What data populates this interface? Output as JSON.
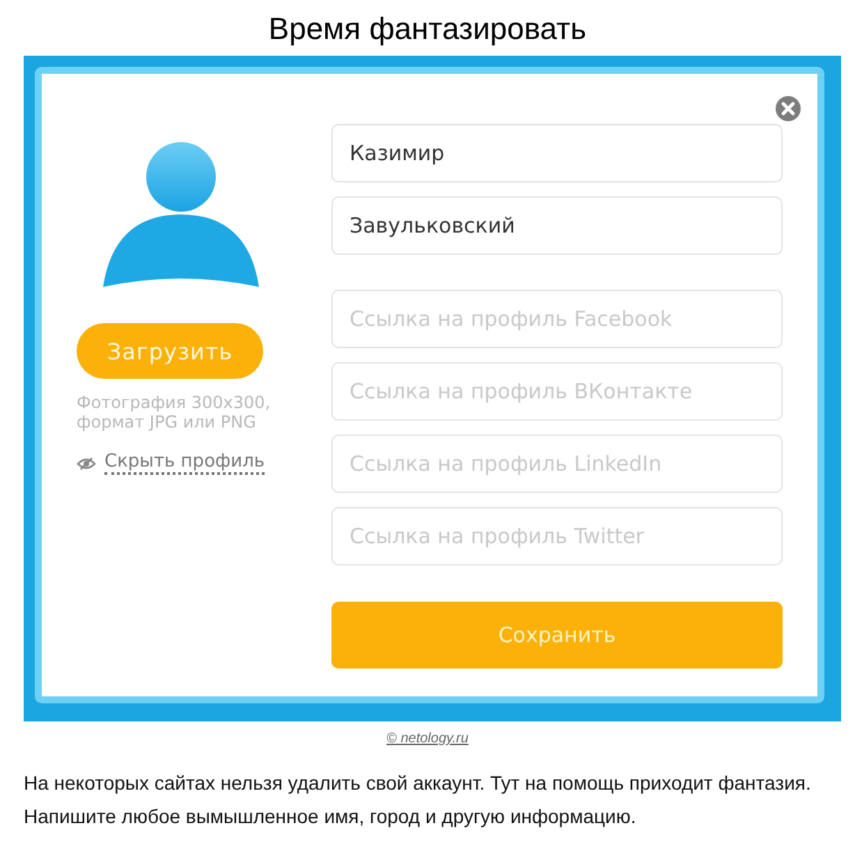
{
  "title": "Время фантазировать",
  "profile": {
    "upload_button": "Загрузить",
    "photo_hint": "Фотография 300x300, формат JPG или PNG",
    "hide_link": "Скрыть профиль"
  },
  "fields": [
    {
      "value": "Казимир"
    },
    {
      "value": "Завульковский"
    },
    {
      "placeholder": "Ссылка на профиль Facebook"
    },
    {
      "placeholder": "Ссылка на профиль ВКонтакте"
    },
    {
      "placeholder": "Ссылка на профиль LinkedIn"
    },
    {
      "placeholder": "Ссылка на профиль Twitter"
    }
  ],
  "save_button": "Сохранить",
  "caption": "© netology.ru",
  "paragraph": "На некоторых сайтах нельзя удалить свой аккаунт. Тут на помощь приходит фантазия. Напишите любое вымышленное имя, город и другую информацию."
}
